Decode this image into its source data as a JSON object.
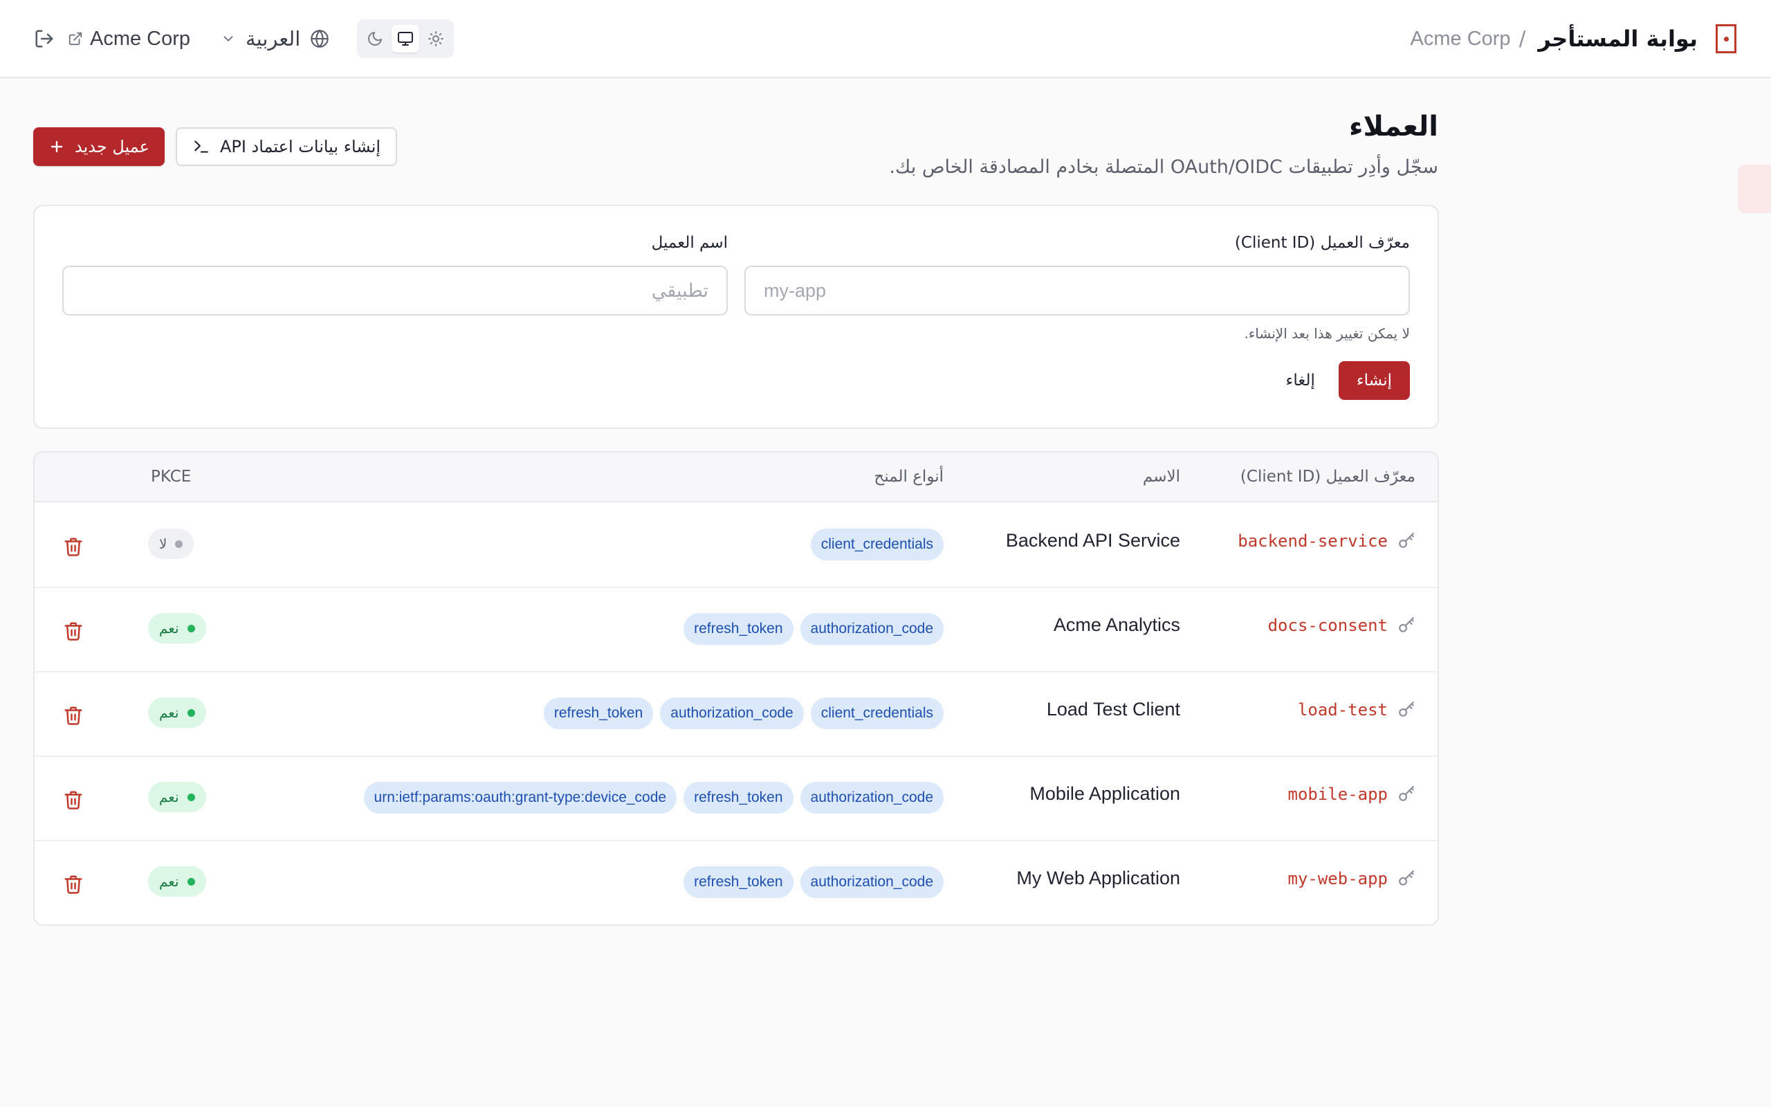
{
  "header": {
    "brand_title": "بوابة المستأجر",
    "separator": "/",
    "org_name": "Acme Corp",
    "org_link_label": "Acme Corp",
    "language_label": "العربية",
    "icons": {
      "logo": "bracket-logo-icon",
      "logout": "logout-icon",
      "external": "external-link-icon",
      "chevron": "chevron-down-icon",
      "globe": "globe-icon",
      "moon": "moon-icon",
      "monitor": "monitor-icon",
      "sun": "sun-icon"
    },
    "theme_selected": "system"
  },
  "page": {
    "title": "العملاء",
    "subtitle": "سجّل وأدِر تطبيقات OAuth/OIDC المتصلة بخادم المصادقة الخاص بك.",
    "new_client_label": "عميل جديد",
    "api_credentials_label": "إنشاء بيانات اعتماد API"
  },
  "form": {
    "client_id_label": "معرّف العميل (Client ID)",
    "client_id_placeholder": "my-app",
    "client_id_value": "",
    "client_id_hint": "لا يمكن تغيير هذا بعد الإنشاء.",
    "client_name_label": "اسم العميل",
    "client_name_placeholder": "تطبيقي",
    "client_name_value": "",
    "create_label": "إنشاء",
    "cancel_label": "إلغاء"
  },
  "table": {
    "columns": {
      "client_id": "معرّف العميل (Client ID)",
      "name": "الاسم",
      "grant_types": "أنواع المنح",
      "pkce": "PKCE"
    },
    "rows": [
      {
        "client_id": "backend-service",
        "name": "Backend API Service",
        "grants": [
          "client_credentials"
        ],
        "pkce": false,
        "pkce_label": "لا"
      },
      {
        "client_id": "docs-consent",
        "name": "Acme Analytics",
        "grants": [
          "authorization_code",
          "refresh_token"
        ],
        "pkce": true,
        "pkce_label": "نعم"
      },
      {
        "client_id": "load-test",
        "name": "Load Test Client",
        "grants": [
          "client_credentials",
          "authorization_code",
          "refresh_token"
        ],
        "pkce": true,
        "pkce_label": "نعم"
      },
      {
        "client_id": "mobile-app",
        "name": "Mobile Application",
        "grants": [
          "authorization_code",
          "refresh_token",
          "urn:ietf:params:oauth:grant-type:device_code"
        ],
        "pkce": true,
        "pkce_label": "نعم"
      },
      {
        "client_id": "my-web-app",
        "name": "My Web Application",
        "grants": [
          "authorization_code",
          "refresh_token"
        ],
        "pkce": true,
        "pkce_label": "نعم"
      }
    ]
  },
  "colors": {
    "accent": "#b4282c",
    "client_id_text": "#c0392b",
    "grant_bg": "#dce9fb",
    "grant_text": "#1d4fb0",
    "pkce_yes_bg": "#dcf7e6",
    "pkce_yes_dot": "#22b35c",
    "pkce_no_bg": "#f0f1f4"
  }
}
